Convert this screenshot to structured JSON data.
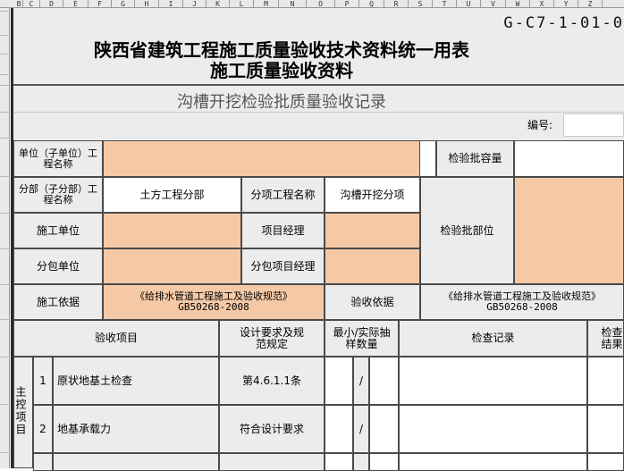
{
  "column_headers": [
    "B",
    "C",
    "D",
    "E",
    "F",
    "G",
    "H",
    "I",
    "J",
    "K",
    "L",
    "M",
    "N",
    "O",
    "P",
    "Q",
    "R",
    "S",
    "T",
    "U",
    "V",
    "W",
    "X",
    "Y",
    "Z"
  ],
  "header": {
    "doc_number": "G-C7-1-01-0",
    "title_line1": "陕西省建筑工程施工质量验收技术资料统一用表",
    "title_line2": "施工质量验收资料",
    "subtitle": "沟槽开挖检验批质量验收记录",
    "serial_label": "编号:"
  },
  "form": {
    "unit_project_label": "单位（子单位）工程名称",
    "batch_capacity_label": "检验批容量",
    "subdivision_label": "分部（子分部）工程名称",
    "subdivision_value": "土方工程分部",
    "subitem_label": "分项工程名称",
    "subitem_value": "沟槽开挖分项",
    "batch_location_label": "检验批部位",
    "construction_unit_label": "施工单位",
    "project_manager_label": "项目经理",
    "subcontractor_label": "分包单位",
    "subcontract_manager_label": "分包项目经理",
    "construction_basis_label": "施工依据",
    "construction_basis_value_line1": "《给排水管道工程施工及验收规范》",
    "construction_basis_value_line2": "GB50268-2008",
    "acceptance_basis_label": "验收依据",
    "acceptance_basis_value_line1": "《给排水管道工程施工及验收规范》",
    "acceptance_basis_value_line2": "GB50268-2008"
  },
  "table": {
    "headers": {
      "item": "验收项目",
      "design_req": "设计要求及规范规定",
      "sample": "最小/实际抽样数量",
      "check_record": "检查记录",
      "check_result": "检查结果"
    },
    "group_label": "主控项目",
    "rows": [
      {
        "no": "1",
        "item": "原状地基土检查",
        "requirement": "第4.6.1.1条",
        "sample": "/"
      },
      {
        "no": "2",
        "item": "地基承载力",
        "requirement": "符合设计要求",
        "sample": "/"
      }
    ]
  },
  "colors": {
    "peach_fill": "#f5c9a6",
    "label_fill": "#ececec",
    "header_fill": "#e9e9e9"
  }
}
